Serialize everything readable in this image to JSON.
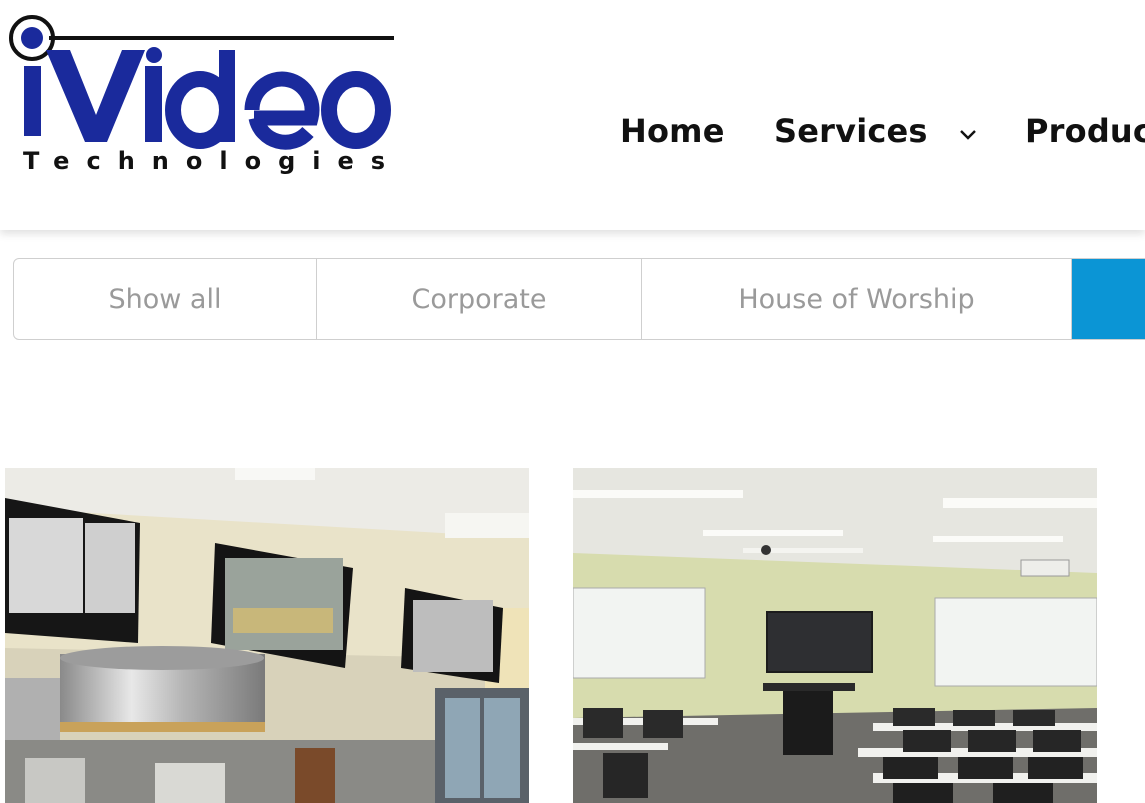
{
  "logo": {
    "brand": "iVideo",
    "tagline": "Technologies",
    "colors": {
      "blue": "#1a2a9c",
      "black": "#111111"
    }
  },
  "nav": {
    "items": [
      {
        "label": "Home"
      },
      {
        "label": "Services",
        "icon": "chevron-down-icon"
      },
      {
        "label": "Product"
      }
    ]
  },
  "filters": {
    "items": [
      {
        "label": "Show all"
      },
      {
        "label": "Corporate"
      },
      {
        "label": "House of Worship"
      },
      {
        "label": ""
      }
    ],
    "active_color": "#0b95d5"
  },
  "gallery": {
    "items": [
      {
        "subject": "teaching kitchen with wall-mounted monitors"
      },
      {
        "subject": "training classroom with display and whiteboards"
      }
    ]
  }
}
